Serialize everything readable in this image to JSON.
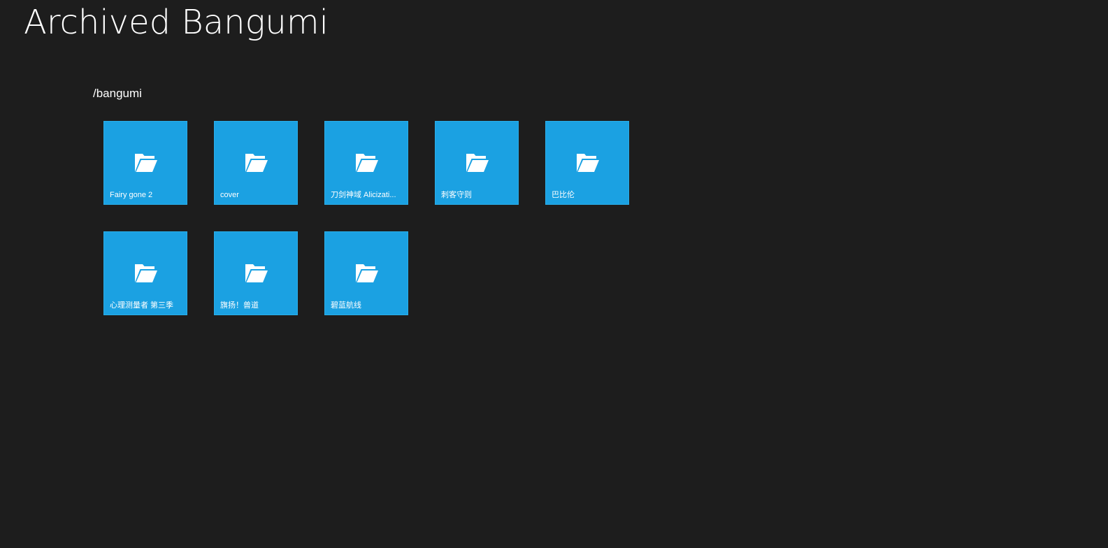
{
  "app": {
    "title": "Archived Bangumi"
  },
  "browser": {
    "path": "/bangumi"
  },
  "colors": {
    "background": "#1d1d1d",
    "tile": "#1ba1e2",
    "text": "#ffffff"
  },
  "folders": [
    {
      "label": "Fairy gone 2",
      "icon": "folder-open-icon"
    },
    {
      "label": "cover",
      "icon": "folder-open-icon"
    },
    {
      "label": "刀剑神域 Alicizati...",
      "icon": "folder-open-icon"
    },
    {
      "label": "刺客守则",
      "icon": "folder-open-icon"
    },
    {
      "label": "巴比伦",
      "icon": "folder-open-icon"
    },
    {
      "label": "心理测量者 第三季",
      "icon": "folder-open-icon"
    },
    {
      "label": "旗扬！兽道",
      "icon": "folder-open-icon"
    },
    {
      "label": "碧蓝航线",
      "icon": "folder-open-icon"
    }
  ]
}
